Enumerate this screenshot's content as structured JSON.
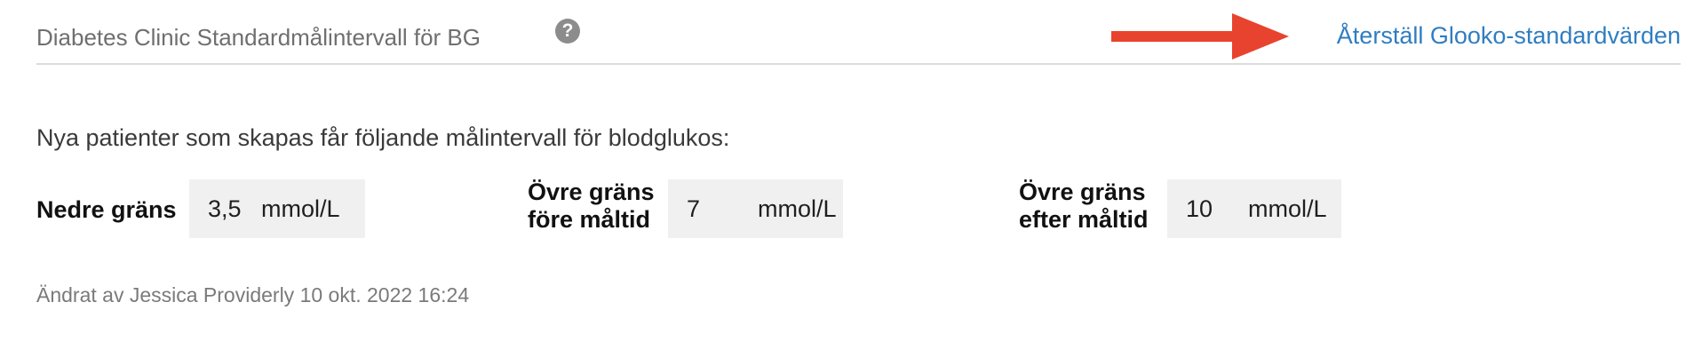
{
  "header": {
    "title": "Diabetes Clinic Standardmålintervall för BG",
    "help_icon": "question-circle-icon",
    "help_glyph": "?",
    "reset_link": "Återställ Glooko-standardvärden",
    "arrow_color": "#e8432e",
    "link_color": "#2f7dc1"
  },
  "intro": "Nya patienter som skapas får följande målintervall för blodglukos:",
  "fields": [
    {
      "label_line1": "Nedre gräns",
      "label_line2": "",
      "value": "3,5",
      "unit": "mmol/L"
    },
    {
      "label_line1": "Övre gräns",
      "label_line2": "före måltid",
      "value": "7",
      "unit": "mmol/L"
    },
    {
      "label_line1": "Övre gräns",
      "label_line2": "efter måltid",
      "value": "10",
      "unit": "mmol/L"
    }
  ],
  "footer": "Ändrat av Jessica Providerly 10 okt. 2022 16:24"
}
